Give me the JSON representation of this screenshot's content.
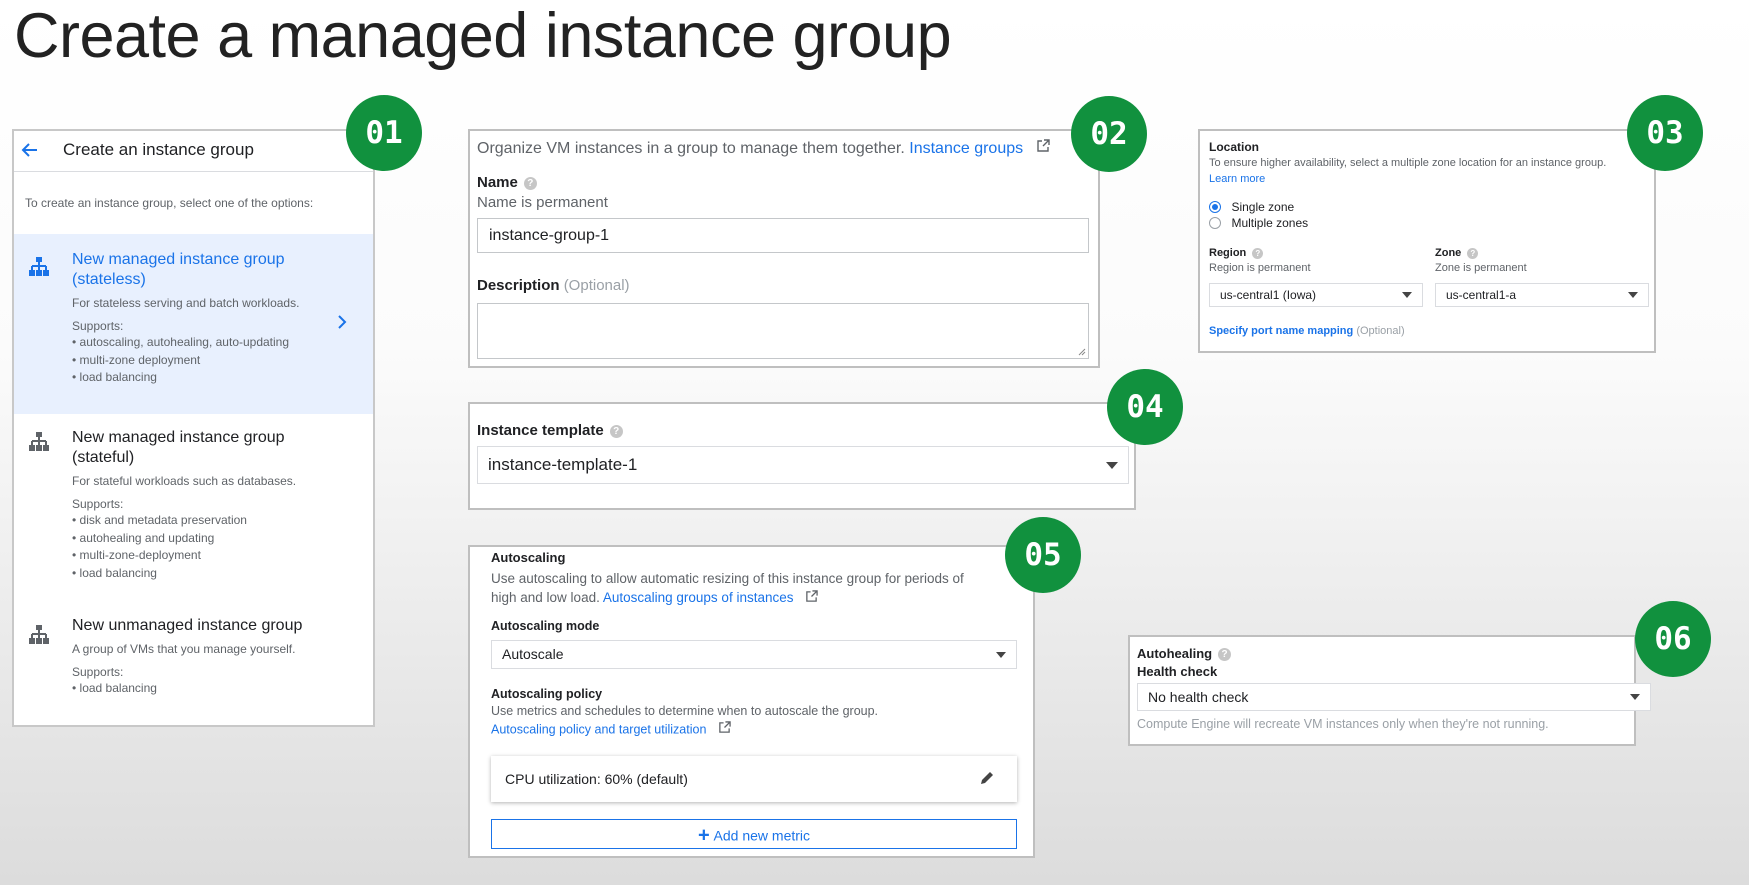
{
  "slide_title": "Create a managed instance group",
  "badges": [
    "01",
    "02",
    "03",
    "04",
    "05",
    "06"
  ],
  "panel1": {
    "header_title": "Create an instance group",
    "intro": "To create an instance group, select one of the options:",
    "options": [
      {
        "title_line1": "New managed instance group",
        "title_line2": "(stateless)",
        "desc": "For stateless serving and batch workloads.",
        "supports_label": "Supports:",
        "supports": [
          "• autoscaling, autohealing, auto-updating",
          "• multi-zone deployment",
          "• load balancing"
        ],
        "icon": "managed-group-icon"
      },
      {
        "title_line1": "New managed instance group",
        "title_line2": "(stateful)",
        "desc": "For stateful workloads such as databases.",
        "supports_label": "Supports:",
        "supports": [
          "• disk and metadata preservation",
          "• autohealing and updating",
          "• multi-zone-deployment",
          "• load balancing"
        ],
        "icon": "managed-group-icon"
      },
      {
        "title_line1": "New unmanaged instance group",
        "desc": "A group of VMs that you manage yourself.",
        "supports_label": "Supports:",
        "supports": [
          "• load balancing"
        ],
        "icon": "unmanaged-group-icon"
      }
    ]
  },
  "panel2": {
    "intro_text": "Organize VM instances in a group to manage them together.",
    "intro_link": "Instance groups",
    "name_label": "Name",
    "name_hint": "Name is permanent",
    "name_value": "instance-group-1",
    "description_label": "Description",
    "description_optional": "(Optional)",
    "description_value": ""
  },
  "panel3": {
    "location_label": "Location",
    "location_hint": "To ensure higher availability, select a multiple zone location for an instance group.",
    "learn_more": "Learn more",
    "radio_single": "Single zone",
    "radio_multiple": "Multiple zones",
    "selected": "Single zone",
    "region_label": "Region",
    "region_hint": "Region is permanent",
    "region_value": "us-central1 (Iowa)",
    "zone_label": "Zone",
    "zone_hint": "Zone is permanent",
    "zone_value": "us-central1-a",
    "port_mapping_link": "Specify port name mapping",
    "port_mapping_optional": "(Optional)"
  },
  "panel4": {
    "template_label": "Instance template",
    "template_value": "instance-template-1"
  },
  "panel5": {
    "title": "Autoscaling",
    "desc_line1": "Use autoscaling to allow automatic resizing of this instance group for periods of",
    "desc_line2": "high and low load.",
    "desc_link": "Autoscaling groups of instances",
    "mode_label": "Autoscaling mode",
    "mode_value": "Autoscale",
    "policy_label": "Autoscaling policy",
    "policy_desc": "Use metrics and schedules to determine when to autoscale the group.",
    "policy_link": "Autoscaling policy and target utilization",
    "metric": "CPU utilization: 60% (default)",
    "add_metric": "Add new metric"
  },
  "panel6": {
    "title": "Autohealing",
    "health_label": "Health check",
    "health_value": "No health check",
    "hint": "Compute Engine will recreate VM instances only when they're not running."
  },
  "colors": {
    "badge": "#11913e",
    "link": "#1a73e8",
    "selected_bg": "#e8f0fe"
  }
}
